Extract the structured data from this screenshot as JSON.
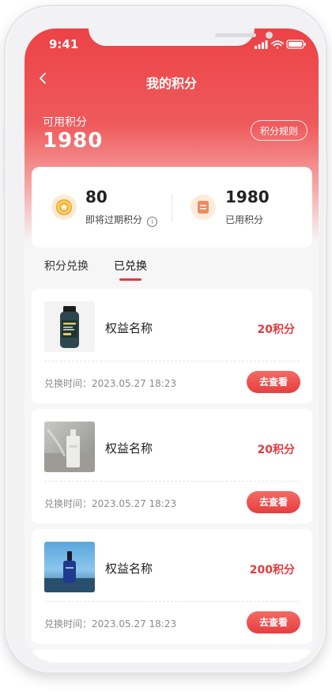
{
  "status_bar": {
    "time": "9:41"
  },
  "header": {
    "title": "我的积分",
    "back_icon": "chevron-left-icon"
  },
  "points": {
    "available_label": "可用积分",
    "available_value": "1980",
    "rules_button": "积分规则"
  },
  "stats": [
    {
      "value": "80",
      "label": "即将过期积分",
      "icon": "star-coin-icon",
      "info_icon": "info-icon"
    },
    {
      "value": "1980",
      "label": "已用积分",
      "icon": "document-icon"
    }
  ],
  "tabs": [
    {
      "label": "积分兑换",
      "active": false
    },
    {
      "label": "已兑换",
      "active": true
    }
  ],
  "items": [
    {
      "name": "权益名称",
      "points": "20积分",
      "time": "兑换时间：2023.05.27 18:23",
      "button": "去查看",
      "image": "supplement-bottle"
    },
    {
      "name": "权益名称",
      "points": "20积分",
      "time": "兑换时间：2023.05.27 18:23",
      "button": "去查看",
      "image": "perfume-bottle"
    },
    {
      "name": "权益名称",
      "points": "200积分",
      "time": "兑换时间：2023.05.27 18:23",
      "button": "去查看",
      "image": "serum-bottle"
    }
  ],
  "colors": {
    "accent": "#e23a3f",
    "header_top": "#ec4246"
  }
}
